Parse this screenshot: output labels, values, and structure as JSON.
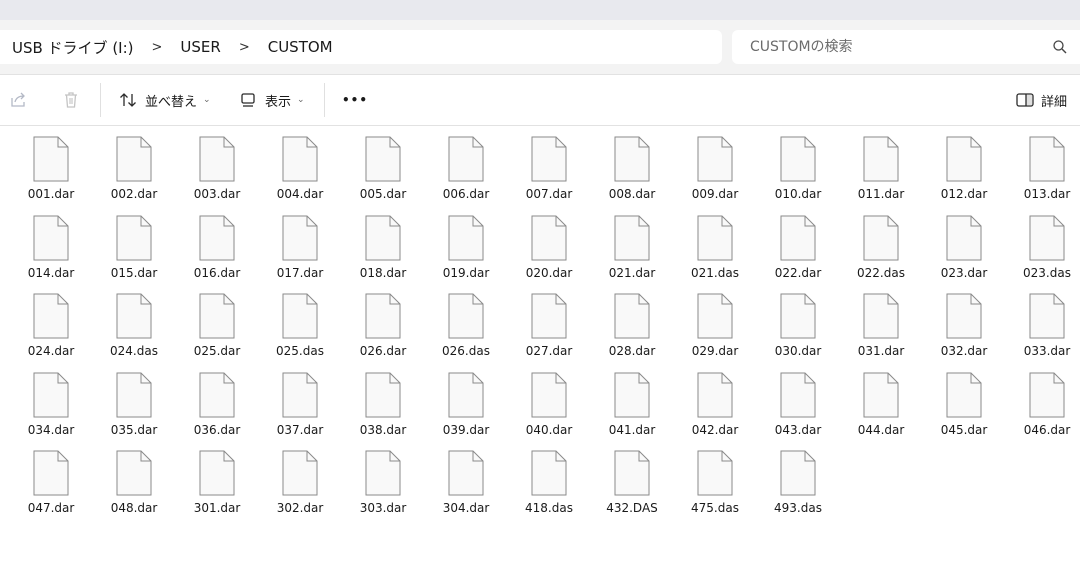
{
  "breadcrumb": {
    "items": [
      "USB ドライブ (I:)",
      "USER",
      "CUSTOM"
    ],
    "separator": ">"
  },
  "search": {
    "placeholder": "CUSTOMの検索",
    "icon": "search-icon"
  },
  "toolbar": {
    "share_icon": "share-icon",
    "delete_icon": "trash-icon",
    "sort_label": "並べ替え",
    "view_label": "表示",
    "more_label": "•••",
    "details_label": "詳細"
  },
  "files": [
    "001.dar",
    "002.dar",
    "003.dar",
    "004.dar",
    "005.dar",
    "006.dar",
    "007.dar",
    "008.dar",
    "009.dar",
    "010.dar",
    "011.dar",
    "012.dar",
    "013.dar",
    "014.dar",
    "015.dar",
    "016.dar",
    "017.dar",
    "018.dar",
    "019.dar",
    "020.dar",
    "021.dar",
    "021.das",
    "022.dar",
    "022.das",
    "023.dar",
    "023.das",
    "024.dar",
    "024.das",
    "025.dar",
    "025.das",
    "026.dar",
    "026.das",
    "027.dar",
    "028.dar",
    "029.dar",
    "030.dar",
    "031.dar",
    "032.dar",
    "033.dar",
    "034.dar",
    "035.dar",
    "036.dar",
    "037.dar",
    "038.dar",
    "039.dar",
    "040.dar",
    "041.dar",
    "042.dar",
    "043.dar",
    "044.dar",
    "045.dar",
    "046.dar",
    "047.dar",
    "048.dar",
    "301.dar",
    "302.dar",
    "303.dar",
    "304.dar",
    "418.das",
    "432.DAS",
    "475.das",
    "493.das"
  ],
  "colors": {
    "toolbar_bg": "#ffffff",
    "address_bg": "#f3f3f3",
    "file_icon_fill": "#f9f9f9",
    "file_icon_stroke": "#8a8a8a"
  }
}
